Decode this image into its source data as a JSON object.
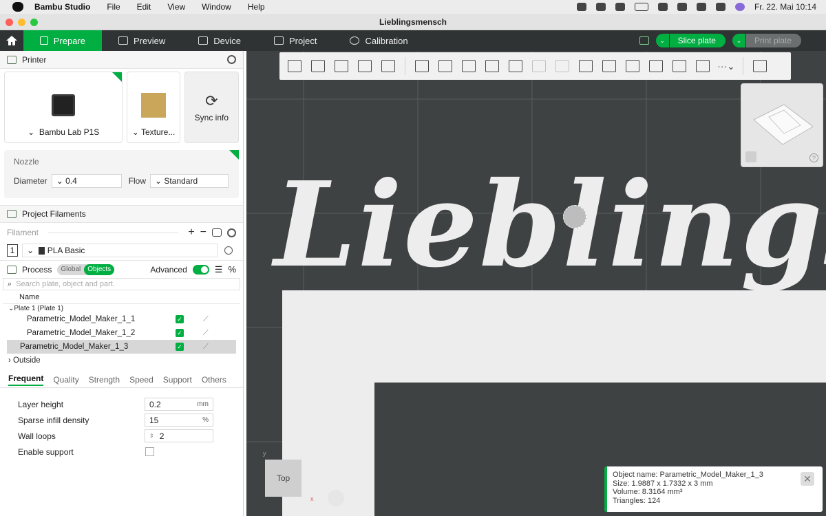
{
  "menubar": {
    "app": "Bambu Studio",
    "items": [
      "File",
      "Edit",
      "View",
      "Window",
      "Help"
    ],
    "datetime": "Fr. 22. Mai  10:14"
  },
  "window": {
    "title": "Lieblingsmensch"
  },
  "tabs": [
    {
      "label": "Prepare"
    },
    {
      "label": "Preview"
    },
    {
      "label": "Device"
    },
    {
      "label": "Project"
    },
    {
      "label": "Calibration"
    }
  ],
  "actions": {
    "slice": "Slice plate",
    "print": "Print plate"
  },
  "printer": {
    "title": "Printer",
    "model": "Bambu Lab P1S",
    "plate": "Texture...",
    "sync": "Sync info"
  },
  "nozzle": {
    "title": "Nozzle",
    "diameter_label": "Diameter",
    "diameter": "0.4",
    "flow_label": "Flow",
    "flow": "Standard"
  },
  "filaments": {
    "title": "Project Filaments",
    "filter_label": "Filament",
    "slot": "1",
    "name": "PLA Basic"
  },
  "process": {
    "title": "Process",
    "global": "Global",
    "objects": "Objects",
    "advanced": "Advanced",
    "search_placeholder": "Search plate, object and part."
  },
  "tree": {
    "header": "Name",
    "plate": "Plate 1 (Plate 1)",
    "items": [
      "Parametric_Model_Maker_1_1",
      "Parametric_Model_Maker_1_2",
      "Parametric_Model_Maker_1_3"
    ],
    "outside": "Outside"
  },
  "settings_tabs": [
    "Frequent",
    "Quality",
    "Strength",
    "Speed",
    "Support",
    "Others"
  ],
  "params": {
    "layer_height_label": "Layer height",
    "layer_height": "0.2",
    "layer_height_unit": "mm",
    "infill_label": "Sparse infill density",
    "infill": "15",
    "infill_unit": "%",
    "walls_label": "Wall loops",
    "walls": "2",
    "support_label": "Enable support"
  },
  "canvas": {
    "model_text": "Lieblingsm",
    "view_cube": "Top",
    "axis_x": "x",
    "axis_y": "y"
  },
  "info": {
    "name": "Object name: Parametric_Model_Maker_1_3",
    "size": "Size: 1.9887 x 1.7332 x 3 mm",
    "volume": "Volume: 8.3164 mm³",
    "triangles": "Triangles: 124"
  }
}
